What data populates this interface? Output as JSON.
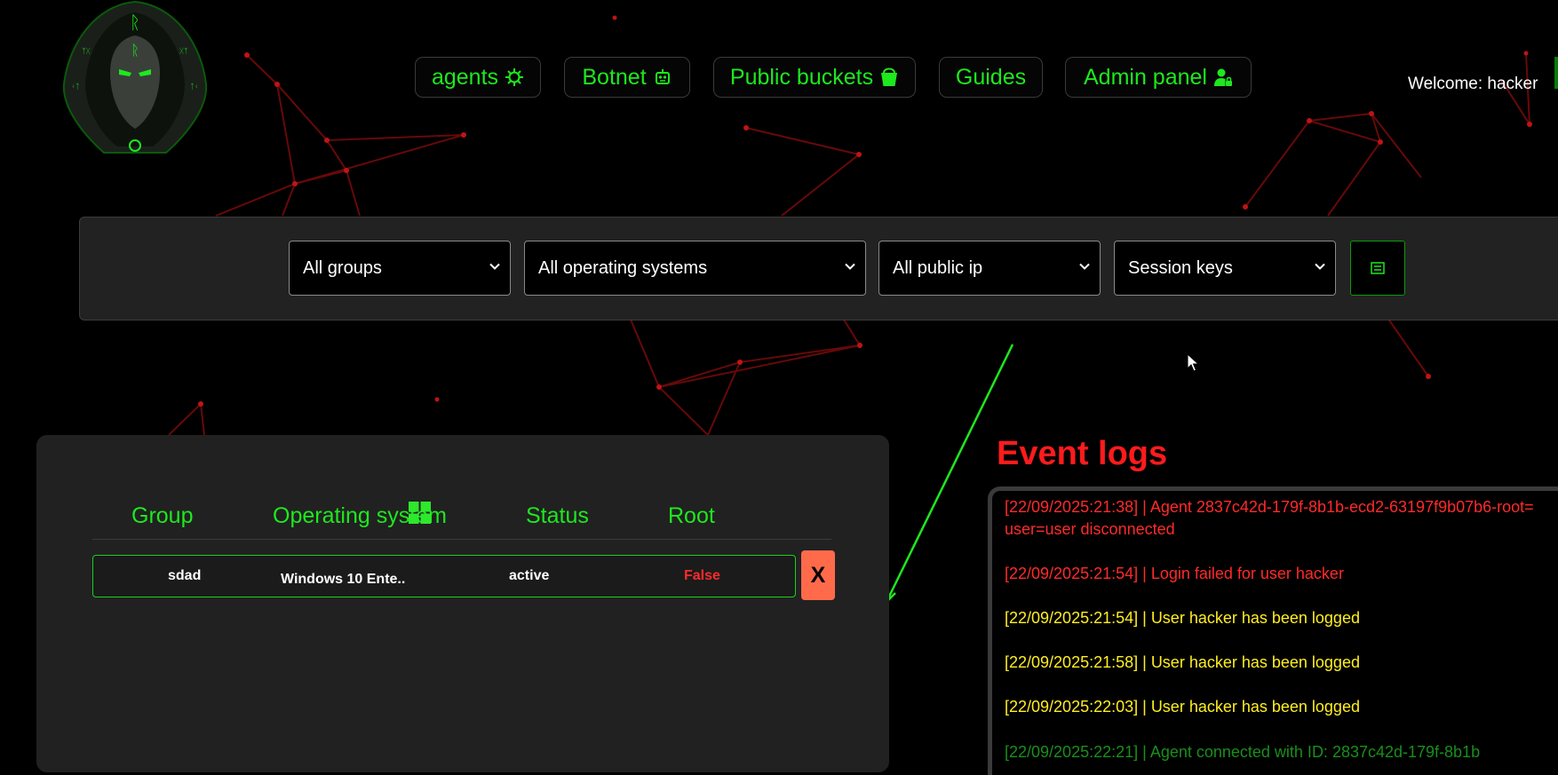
{
  "nav": {
    "agents": "agents",
    "botnet": "Botnet",
    "buckets": "Public buckets",
    "guides": "Guides",
    "admin": "Admin panel"
  },
  "welcome": "Welcome: hacker",
  "filters": {
    "groups": "All groups",
    "os": "All operating systems",
    "public_ip": "All public ip",
    "session_keys": "Session keys"
  },
  "agents_table": {
    "headers": [
      "Group",
      "Operating system",
      "Status",
      "Root"
    ],
    "rows": [
      {
        "group": "sdad",
        "os": "Windows 10 Ente..",
        "status": "active",
        "root": "False",
        "remove": "X"
      }
    ]
  },
  "event_logs": {
    "title": "Event logs",
    "entries": [
      "[22/09/2025:21:38] | Agent 2837c42d-179f-8b1b-ecd2-63197f9b07b6-root= user=user disconnected",
      "[22/09/2025:21:54] | Login failed for user hacker",
      "[22/09/2025:21:54] | User hacker has been logged",
      "[22/09/2025:21:58] | User hacker has been logged",
      "[22/09/2025:22:03] | User hacker has been logged",
      "[22/09/2025:22:21] | Agent connected with ID: 2837c42d-179f-8b1b"
    ]
  },
  "colors": {
    "accent": "#1ee81e",
    "error": "#ff2a2a",
    "warning": "#ffee22",
    "panel": "#222222",
    "remove_button": "#ff6b4a"
  },
  "icons": {
    "agents": "virus-icon",
    "botnet": "robot-icon",
    "buckets": "bucket-icon",
    "admin": "user-lock-icon",
    "filter_button": "list-icon",
    "os": "windows-icon"
  }
}
